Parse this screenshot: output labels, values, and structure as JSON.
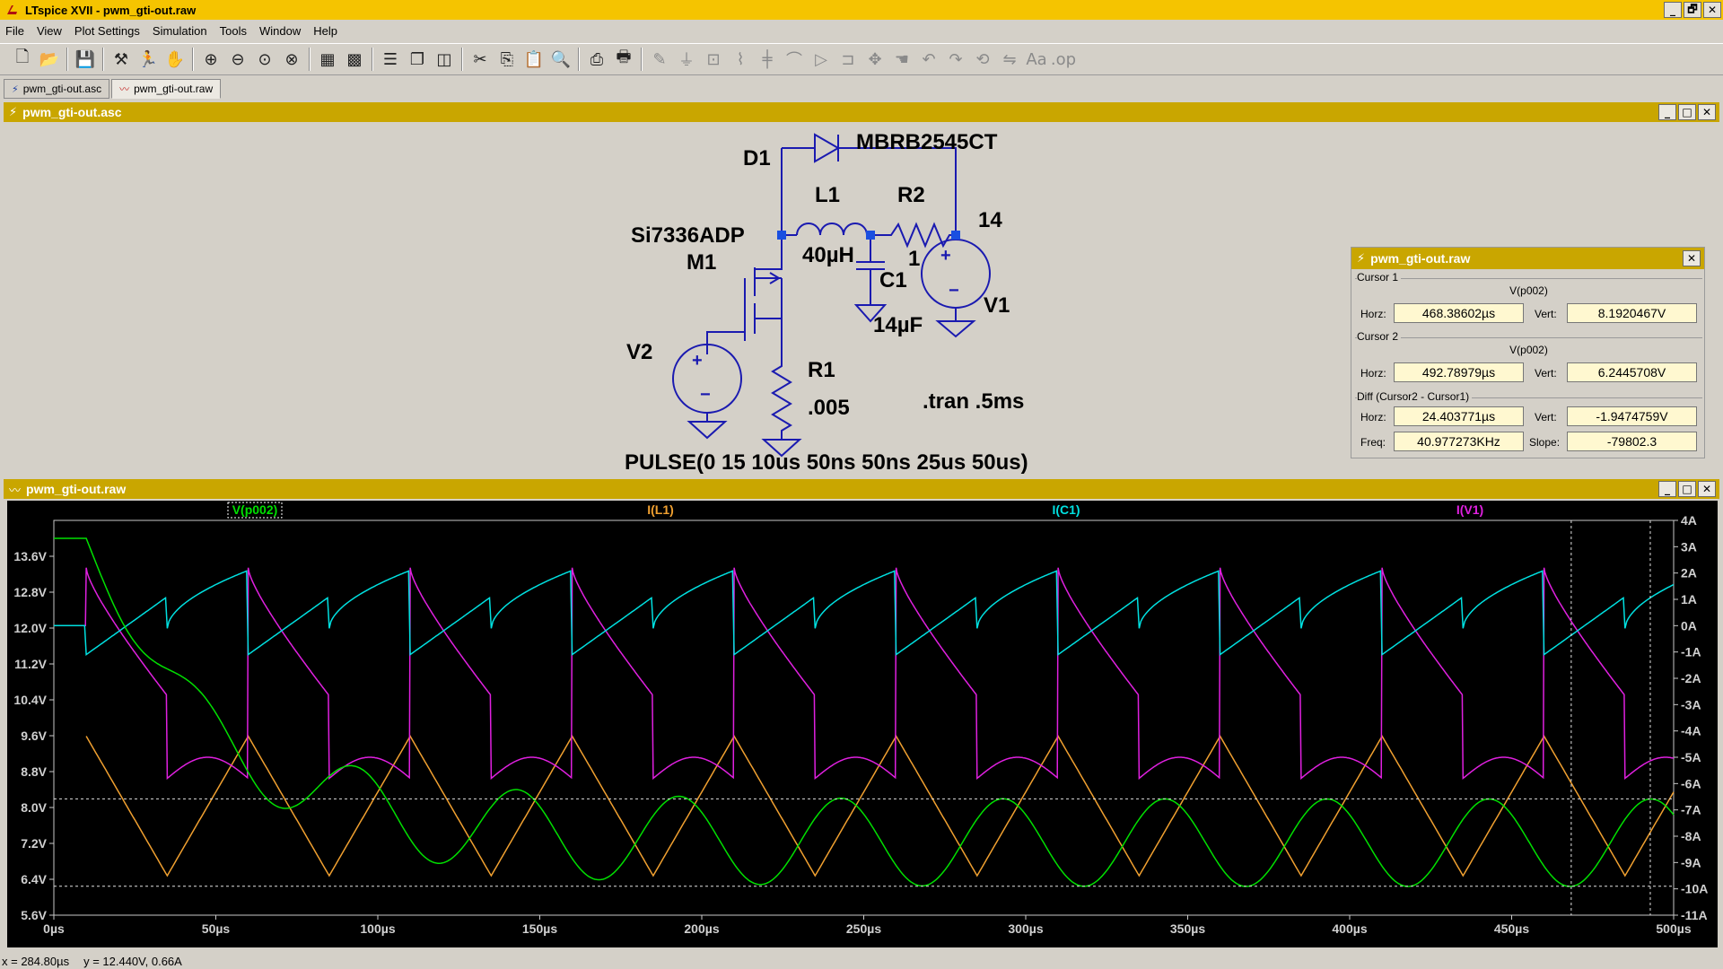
{
  "window": {
    "title": "LTspice XVII - pwm_gti-out.raw",
    "btn_min": "_",
    "btn_restore": "🗗",
    "btn_close": "✕"
  },
  "menu": [
    "File",
    "View",
    "Plot Settings",
    "Simulation",
    "Tools",
    "Window",
    "Help"
  ],
  "toolbar_icons": [
    "new-schematic-icon",
    "open-icon",
    "save-icon",
    "control-panel-icon",
    "run-icon",
    "halt-icon",
    "zoom-in-icon",
    "zoom-out-icon",
    "zoom-fit-icon",
    "zoom-cancel-icon",
    "autorange-icon",
    "grid-icon",
    "tile-horizontal-icon",
    "cascade-icon",
    "tile-vertical-icon",
    "cut-icon",
    "copy-icon",
    "paste-icon",
    "find-icon",
    "print-icon",
    "print-setup-icon",
    "wire-icon",
    "ground-icon",
    "label-icon",
    "resistor-icon",
    "capacitor-icon",
    "inductor-icon",
    "diode-icon",
    "component-icon",
    "move-icon",
    "drag-icon",
    "undo-icon",
    "redo-icon",
    "rotate-icon",
    "mirror-icon",
    "text-icon",
    "spice-directive-icon"
  ],
  "doc_tabs": [
    {
      "label": "pwm_gti-out.asc",
      "active": false
    },
    {
      "label": "pwm_gti-out.raw",
      "active": true
    }
  ],
  "schematic_window": {
    "title": "pwm_gti-out.asc",
    "labels": {
      "d1": "D1",
      "d1_model": "MBRB2545CT",
      "l1": "L1",
      "l1_value": "40µH",
      "r2": "R2",
      "r2_value": "1",
      "v1_value": "14",
      "v1": "V1",
      "m1_model": "Si7336ADP",
      "m1": "M1",
      "c1": "C1",
      "c1_value": "14µF",
      "v2": "V2",
      "r1": "R1",
      "r1_value": ".005",
      "tran": ".tran .5ms",
      "pulse": "PULSE(0 15 10us 50ns 50ns 25us 50us)"
    }
  },
  "cursor_panel": {
    "title": "pwm_gti-out.raw",
    "cursor1": {
      "label": "Cursor 1",
      "signal": "V(p002)",
      "horz": "468.38602µs",
      "vert": "8.1920467V"
    },
    "cursor2": {
      "label": "Cursor 2",
      "signal": "V(p002)",
      "horz": "492.78979µs",
      "vert": "6.2445708V"
    },
    "diff": {
      "label": "Diff (Cursor2 - Cursor1)",
      "horz": "24.403771µs",
      "vert": "-1.9474759V",
      "freq": "40.977273KHz",
      "slope": "-79802.3"
    },
    "field_labels": {
      "horz": "Horz:",
      "vert": "Vert:",
      "freq": "Freq:",
      "slope": "Slope:"
    }
  },
  "waveform_window": {
    "title": "pwm_gti-out.raw",
    "traces": [
      {
        "name": "V(p002)",
        "color": "#00e000"
      },
      {
        "name": "I(L1)",
        "color": "#f0a030"
      },
      {
        "name": "I(C1)",
        "color": "#00e0e0"
      },
      {
        "name": "I(V1)",
        "color": "#e020e0"
      }
    ]
  },
  "chart_data": {
    "type": "line",
    "x_label_unit": "µs",
    "x_ticks": [
      "0µs",
      "50µs",
      "100µs",
      "150µs",
      "200µs",
      "250µs",
      "300µs",
      "350µs",
      "400µs",
      "450µs",
      "500µs"
    ],
    "xlim": [
      0,
      500
    ],
    "left_axis": {
      "unit": "V",
      "ticks": [
        "13.6V",
        "12.8V",
        "12.0V",
        "11.2V",
        "10.4V",
        "9.6V",
        "8.8V",
        "8.0V",
        "7.2V",
        "6.4V",
        "5.6V"
      ],
      "range": [
        5.6,
        14.4
      ]
    },
    "right_axis": {
      "unit": "A",
      "ticks": [
        "4A",
        "3A",
        "2A",
        "1A",
        "0A",
        "-1A",
        "-2A",
        "-3A",
        "-4A",
        "-5A",
        "-6A",
        "-7A",
        "-8A",
        "-9A",
        "-10A",
        "-11A"
      ],
      "range": [
        -11,
        4
      ]
    },
    "period_us": 50,
    "series": [
      {
        "name": "V(p002)",
        "axis": "left",
        "min": 6.24,
        "max": 8.19
      },
      {
        "name": "I(L1)",
        "axis": "right",
        "min": -9.5,
        "max": -4.2
      },
      {
        "name": "I(C1)",
        "axis": "right",
        "min": -2.2,
        "max": 2.2
      },
      {
        "name": "I(V1)",
        "axis": "right",
        "min": -7.3,
        "max": 2.2
      }
    ],
    "cursors": {
      "c1_x": 468.386,
      "c1_y": 8.192,
      "c2_x": 492.79,
      "c2_y": 6.2446
    },
    "grid": false
  },
  "status": {
    "x": "x = 284.80µs",
    "y": "y = 12.440V, 0.66A"
  }
}
